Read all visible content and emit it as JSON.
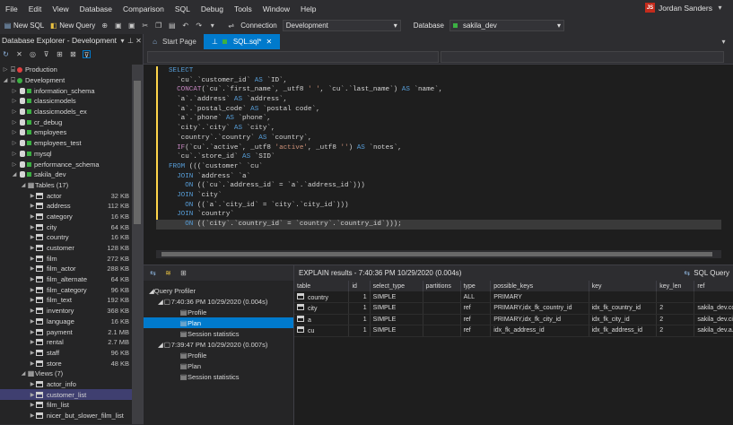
{
  "menu": [
    "File",
    "Edit",
    "View",
    "Database",
    "Comparison",
    "SQL",
    "Debug",
    "Tools",
    "Window",
    "Help"
  ],
  "user": {
    "initials": "JS",
    "name": "Jordan Sanders"
  },
  "toolbar": {
    "new_sql": "New SQL",
    "new_query": "New Query",
    "connection_label": "Connection",
    "connection_value": "Development",
    "database_label": "Database",
    "database_value": "sakila_dev"
  },
  "explorer": {
    "title": "Database Explorer - Development",
    "servers": [
      {
        "name": "Production"
      },
      {
        "name": "Development"
      }
    ],
    "databases": [
      "information_schema",
      "classicmodels",
      "classicmodels_ex",
      "cr_debug",
      "employees",
      "employees_test",
      "mysql",
      "performance_schema",
      "sakila_dev"
    ],
    "tables_header": "Tables (17)",
    "tables": [
      [
        "actor",
        "32 KB"
      ],
      [
        "address",
        "112 KB"
      ],
      [
        "category",
        "16 KB"
      ],
      [
        "city",
        "64 KB"
      ],
      [
        "country",
        "16 KB"
      ],
      [
        "customer",
        "128 KB"
      ],
      [
        "film",
        "272 KB"
      ],
      [
        "film_actor",
        "288 KB"
      ],
      [
        "film_alternate",
        "64 KB"
      ],
      [
        "film_category",
        "96 KB"
      ],
      [
        "film_text",
        "192 KB"
      ],
      [
        "inventory",
        "368 KB"
      ],
      [
        "language",
        "16 KB"
      ],
      [
        "payment",
        "2.1 MB"
      ],
      [
        "rental",
        "2.7 MB"
      ],
      [
        "staff",
        "96 KB"
      ],
      [
        "store",
        "48 KB"
      ]
    ],
    "views_header": "Views (7)",
    "views": [
      "actor_info",
      "customer_list",
      "film_list",
      "nicer_but_slower_film_list"
    ]
  },
  "tabs": [
    {
      "label": "Start Page"
    },
    {
      "label": "SQL.sql*"
    }
  ],
  "code": [
    [
      [
        "k",
        "SELECT"
      ]
    ],
    [
      [
        "p",
        "  `cu`.`customer_id` "
      ],
      [
        "k",
        "AS"
      ],
      [
        "p",
        " `ID`,"
      ]
    ],
    [
      [
        "p",
        "  "
      ],
      [
        "f",
        "CONCAT"
      ],
      [
        "p",
        "(`cu`.`first_name`, _utf8 "
      ],
      [
        "s",
        "' '"
      ],
      [
        "p",
        ", `cu`.`last_name`) "
      ],
      [
        "k",
        "AS"
      ],
      [
        "p",
        " `name`,"
      ]
    ],
    [
      [
        "p",
        "  `a`.`address` "
      ],
      [
        "k",
        "AS"
      ],
      [
        "p",
        " `address`,"
      ]
    ],
    [
      [
        "p",
        "  `a`.`postal_code` "
      ],
      [
        "k",
        "AS"
      ],
      [
        "p",
        " `postal code`,"
      ]
    ],
    [
      [
        "p",
        "  `a`.`phone` "
      ],
      [
        "k",
        "AS"
      ],
      [
        "p",
        " `phone`,"
      ]
    ],
    [
      [
        "p",
        "  `city`.`city` "
      ],
      [
        "k",
        "AS"
      ],
      [
        "p",
        " `city`,"
      ]
    ],
    [
      [
        "p",
        "  `country`.`country` "
      ],
      [
        "k",
        "AS"
      ],
      [
        "p",
        " `country`,"
      ]
    ],
    [
      [
        "p",
        "  "
      ],
      [
        "f",
        "IF"
      ],
      [
        "p",
        "(`cu`.`active`, _utf8 "
      ],
      [
        "s",
        "'active'"
      ],
      [
        "p",
        ", _utf8 "
      ],
      [
        "s",
        "''"
      ],
      [
        "p",
        ") "
      ],
      [
        "k",
        "AS"
      ],
      [
        "p",
        " `notes`,"
      ]
    ],
    [
      [
        "p",
        "  `cu`.`store_id` "
      ],
      [
        "k",
        "AS"
      ],
      [
        "p",
        " `SID`"
      ]
    ],
    [
      [
        "k",
        "FROM"
      ],
      [
        "p",
        " (((`customer` `cu`"
      ]
    ],
    [
      [
        "p",
        "  "
      ],
      [
        "k",
        "JOIN"
      ],
      [
        "p",
        " `address` `a`"
      ]
    ],
    [
      [
        "p",
        "    "
      ],
      [
        "k",
        "ON"
      ],
      [
        "p",
        " ((`cu`.`address_id` = `a`.`address_id`)))"
      ]
    ],
    [
      [
        "p",
        "  "
      ],
      [
        "k",
        "JOIN"
      ],
      [
        "p",
        " `city`"
      ]
    ],
    [
      [
        "p",
        "    "
      ],
      [
        "k",
        "ON"
      ],
      [
        "p",
        " ((`a`.`city_id` = `city`.`city_id`)))"
      ]
    ],
    [
      [
        "p",
        "  "
      ],
      [
        "k",
        "JOIN"
      ],
      [
        "p",
        " `country`"
      ]
    ],
    [
      [
        "p",
        "    "
      ],
      [
        "k",
        "ON"
      ],
      [
        "p",
        " ((`city`.`country_id` = `country`.`country_id`)));"
      ]
    ]
  ],
  "profiler": {
    "title": "Query Profiler",
    "runs": [
      {
        "label": "7:40:36 PM 10/29/2020 (0.004s)",
        "items": [
          "Profile",
          "Plan",
          "Session statistics"
        ]
      },
      {
        "label": "7:39:47 PM 10/29/2020 (0.007s)",
        "items": [
          "Profile",
          "Plan",
          "Session statistics"
        ]
      }
    ]
  },
  "results": {
    "title": "EXPLAIN results - 7:40:36 PM 10/29/2020 (0.004s)",
    "query_label": "SQL Query",
    "columns": [
      "table",
      "id",
      "select_type",
      "partitions",
      "type",
      "possible_keys",
      "key",
      "key_len",
      "ref"
    ],
    "rows": [
      [
        "country",
        "1",
        "SIMPLE",
        "",
        "ALL",
        "PRIMARY",
        "",
        "",
        ""
      ],
      [
        "city",
        "1",
        "SIMPLE",
        "",
        "ref",
        "PRIMARY,idx_fk_country_id",
        "idx_fk_country_id",
        "2",
        "sakila_dev.country"
      ],
      [
        "a",
        "1",
        "SIMPLE",
        "",
        "ref",
        "PRIMARY,idx_fk_city_id",
        "idx_fk_city_id",
        "2",
        "sakila_dev.city.city"
      ],
      [
        "cu",
        "1",
        "SIMPLE",
        "",
        "ref",
        "idx_fk_address_id",
        "idx_fk_address_id",
        "2",
        "sakila_dev.a.addre"
      ]
    ]
  },
  "colors": {
    "accent": "#007acc",
    "keyword": "#569cd6",
    "function": "#c586c0",
    "string": "#ce9178",
    "server_red": "#e04040",
    "db_green": "#3cb043"
  }
}
